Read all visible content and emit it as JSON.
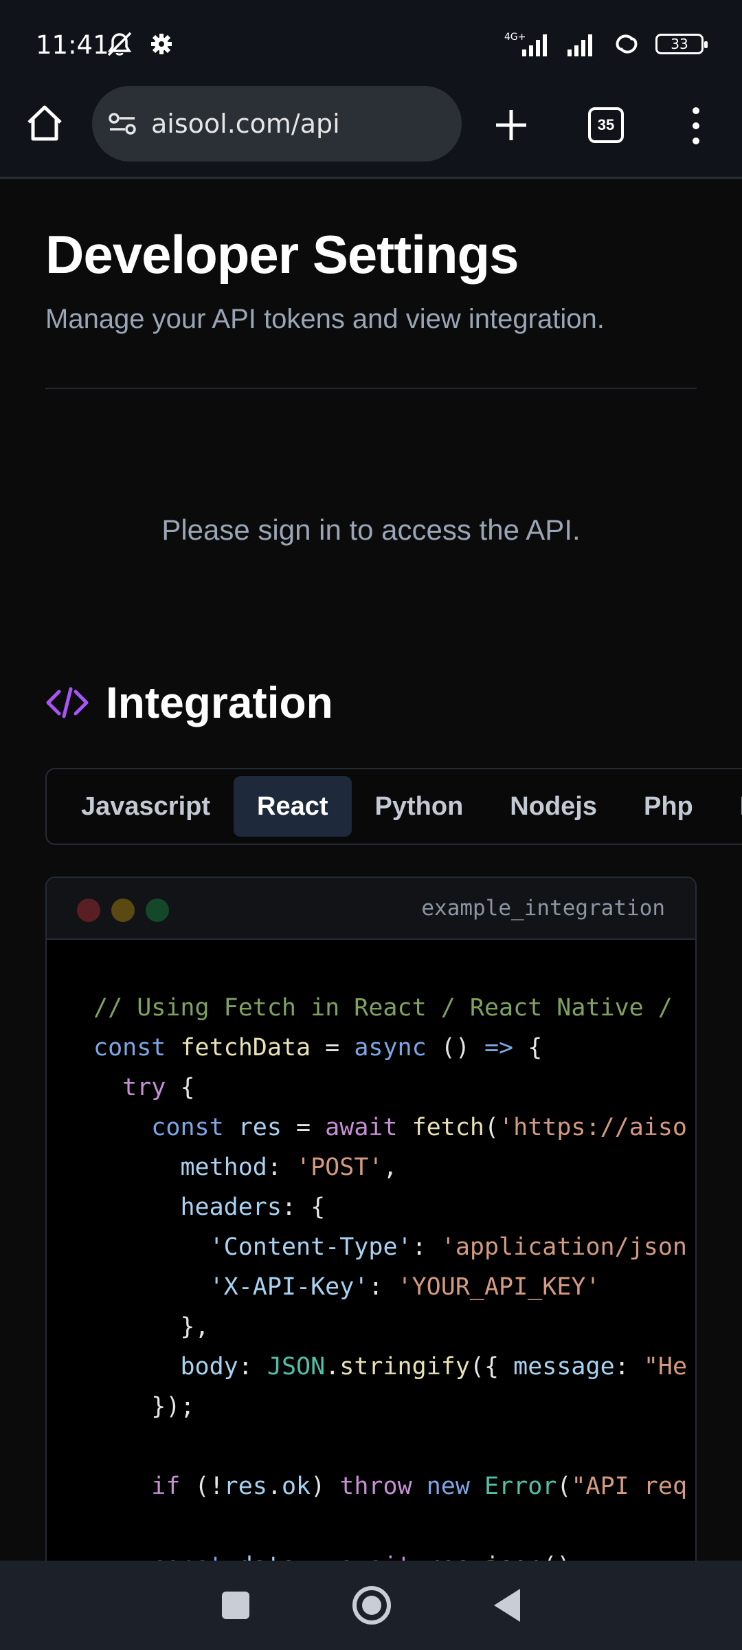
{
  "status_bar": {
    "time": "11:41",
    "network": "4G+",
    "battery": "33"
  },
  "browser": {
    "url": "aisool.com/api",
    "tab_count": "35"
  },
  "page": {
    "title": "Developer Settings",
    "subtitle": "Manage your API tokens and view integration.",
    "signin_message": "Please sign in to access the API."
  },
  "integration": {
    "title": "Integration",
    "tabs": [
      {
        "label": "Javascript"
      },
      {
        "label": "React"
      },
      {
        "label": "Python"
      },
      {
        "label": "Nodejs"
      },
      {
        "label": "Php"
      },
      {
        "label": "Flu"
      }
    ],
    "active_tab": "React",
    "file_name": "example_integration",
    "code_lines": [
      "// Using Fetch in React / React Native /",
      "const fetchData = async () => {",
      "  try {",
      "    const res = await fetch('https://aiso",
      "      method: 'POST',",
      "      headers: {",
      "        'Content-Type': 'application/json",
      "        'X-API-Key': 'YOUR_API_KEY'",
      "      },",
      "      body: JSON.stringify({ message: \"He",
      "    });",
      "",
      "    if (!res.ok) throw new Error(\"API req",
      "",
      "    const data = await res.json();"
    ]
  },
  "colors": {
    "accent": "#a855f7",
    "active_tab_bg": "#1e293b"
  }
}
